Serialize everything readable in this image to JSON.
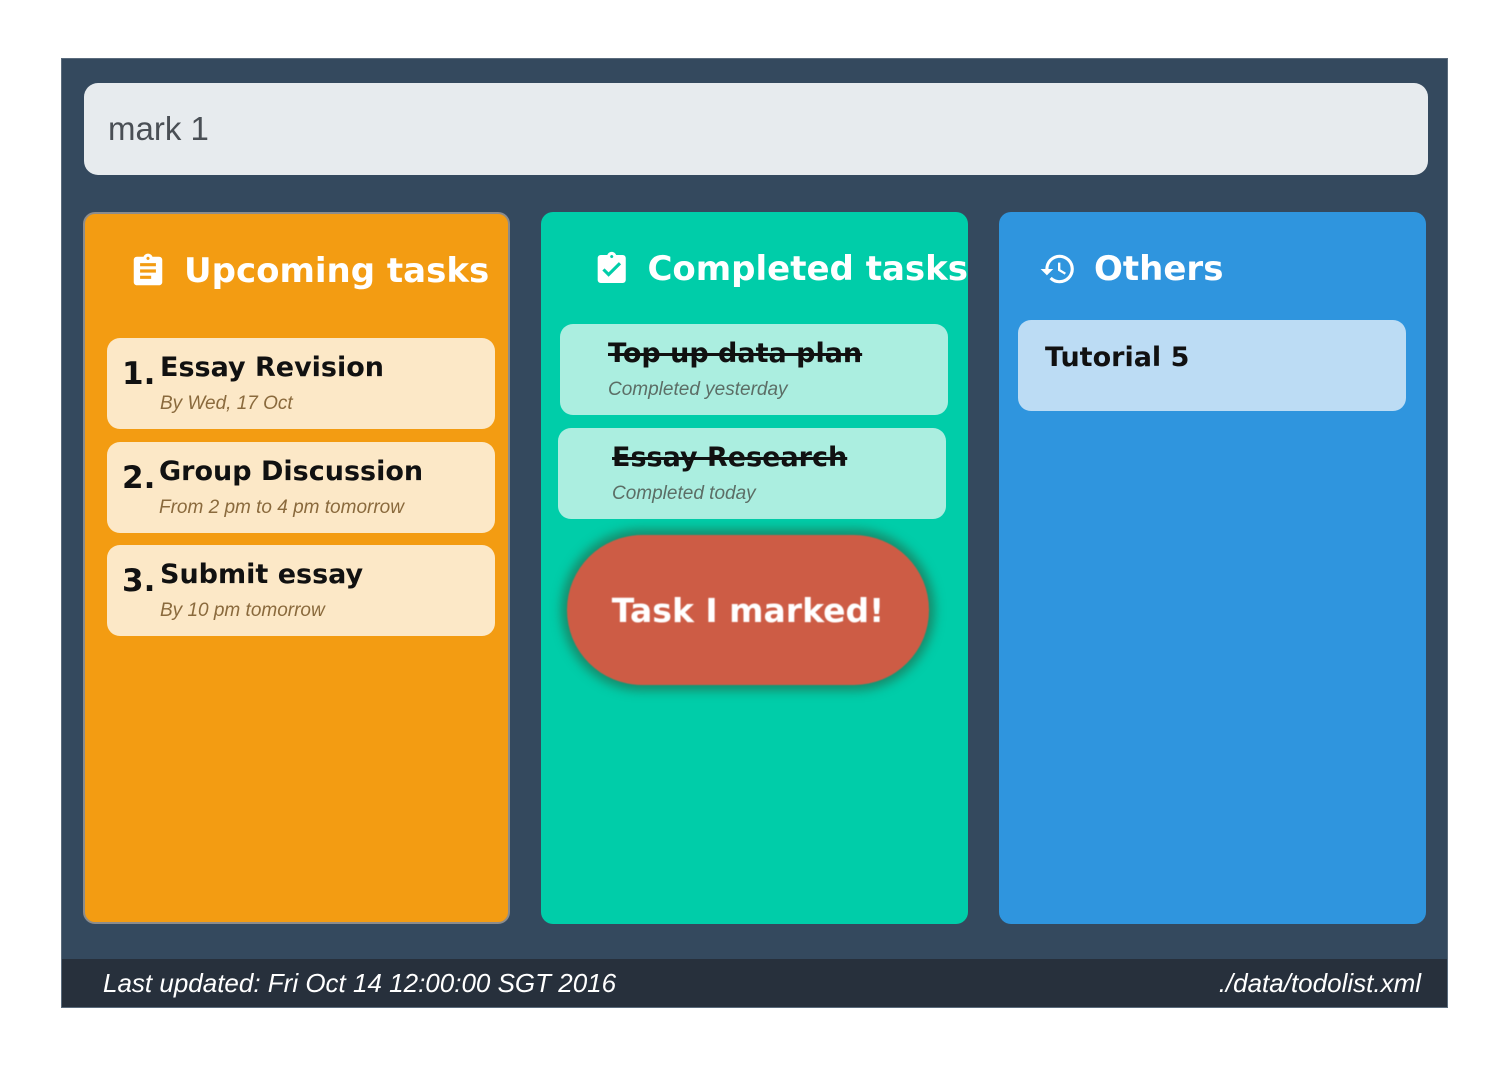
{
  "command_box": {
    "value": "mark 1"
  },
  "panels": {
    "upcoming": {
      "title": "Upcoming tasks",
      "icon": "clipboard-list-icon",
      "tasks": [
        {
          "index": "1.",
          "title": "Essay Revision",
          "subtitle": "By Wed, 17 Oct"
        },
        {
          "index": "2.",
          "title": "Group Discussion",
          "subtitle": "From 2 pm to 4 pm tomorrow"
        },
        {
          "index": "3.",
          "title": "Submit essay",
          "subtitle": "By 10 pm tomorrow"
        }
      ]
    },
    "completed": {
      "title": "Completed tasks",
      "icon": "clipboard-check-icon",
      "tasks": [
        {
          "title": "Top up data plan",
          "subtitle": "Completed yesterday"
        },
        {
          "title": "Essay Research",
          "subtitle": "Completed today"
        }
      ],
      "toast": "Task I marked!"
    },
    "others": {
      "title": "Others",
      "icon": "history-icon",
      "tasks": [
        {
          "title": "Tutorial 5"
        }
      ]
    }
  },
  "status_bar": {
    "last_updated": "Last updated: Fri Oct 14 12:00:00 SGT 2016",
    "file_path": "./data/todolist.xml"
  },
  "colors": {
    "background": "#34495e",
    "upcoming": "#f39c12",
    "completed": "#00cda9",
    "others": "#2f95de",
    "toast": "#cd5c45"
  }
}
